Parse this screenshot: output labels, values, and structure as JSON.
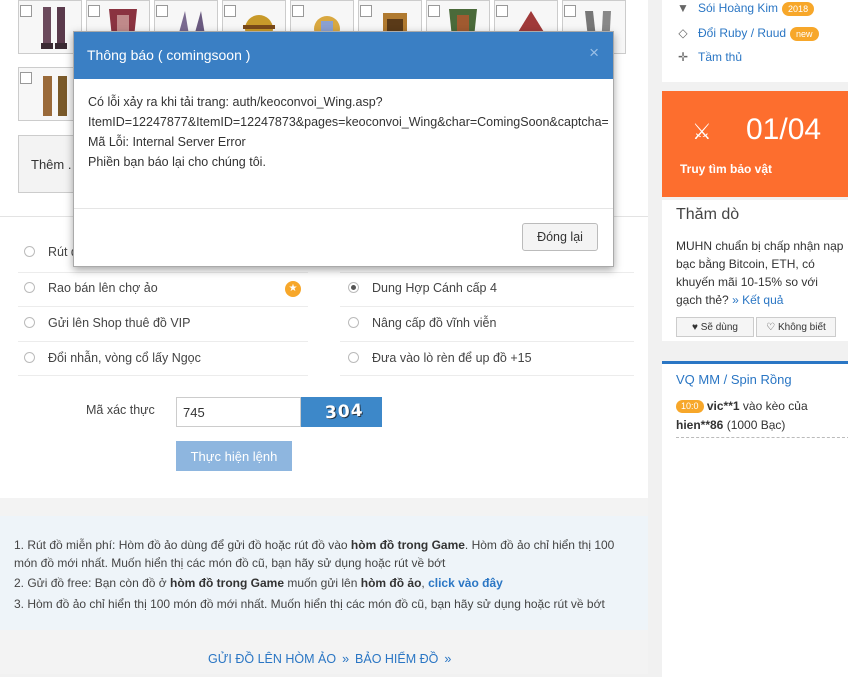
{
  "items": [
    {
      "name": "item-boots"
    },
    {
      "name": "item-armor"
    },
    {
      "name": "item-gloves"
    },
    {
      "name": "item-helmet-gold"
    },
    {
      "name": "item-helmet-blue"
    },
    {
      "name": "item-gauntlet"
    },
    {
      "name": "item-armor-green"
    },
    {
      "name": "item-helm-red"
    },
    {
      "name": "item-boots-grey"
    },
    {
      "name": "item-leg-armor"
    }
  ],
  "add_button": "Thêm .",
  "options": {
    "withdraw": "Rút đ",
    "sell_market": "Rao bán lên chợ ảo",
    "rent_vip": "Gửi lên Shop thuê đồ VIP",
    "swap_ring": "Đổi nhẫn, vòng cổ lấy Ngọc",
    "merge_wing": "Dung Hợp Cánh cấp 4",
    "upgrade_forever": "Nâng cấp đồ vĩnh viễn",
    "forge_15": "Đưa vào lò rèn để up đồ +15",
    "star_badge": "★"
  },
  "captcha": {
    "label": "Mã xác thực",
    "value": "745",
    "image_text": "304"
  },
  "execute_button": "Thực hiện lệnh",
  "notes": {
    "line1_a": "1. Rút đồ miễn phí: Hòm đồ ảo dùng để gửi đồ hoặc rút đồ vào ",
    "line1_b": "hòm đồ trong Game",
    "line1_c": ". Hòm đồ ảo chỉ hiển thị 100 món đồ mới nhất. Muốn hiển thị các món đồ cũ, bạn hãy sử dụng hoặc rút về bớt",
    "line2_a": "2. Gửi đồ free: Bạn còn đồ ở ",
    "line2_b": "hòm đồ trong Game",
    "line2_c": " muốn gửi lên ",
    "line2_d": "hòm đồ ảo",
    "line2_e": ", ",
    "line2_link": "click vào đây",
    "line3": "3. Hòm đồ ảo chỉ hiển thị 100 món đồ mới nhất. Muốn hiển thị các món đồ cũ, bạn hãy sử dụng hoặc rút về bớt"
  },
  "footer": {
    "link1": "GỬI ĐỒ LÊN HÒM ẢO",
    "chev": "»",
    "link2": "BẢO HIỂM ĐỒ"
  },
  "sidebar": {
    "row1": "Sói Hoàng Kim",
    "row1_badge": "2018",
    "row2": "Đổi Ruby / Ruud",
    "row2_badge": "new",
    "row3": "Tầm thủ",
    "treasure_count": "01/04",
    "treasure_label": "Truy tìm bảo vật",
    "poll_title": "Thăm dò",
    "poll_text": "MUHN chuẩn bị chấp nhận nạp bạc bằng Bitcoin, ETH, có khuyến mãi 10-15% so với gạch thẻ?",
    "poll_result": "» Kết quả",
    "poll_yes": "♥ Sẽ dùng",
    "poll_no": "♡ Không biết",
    "spin_title": "VQ MM / Spin Rồng",
    "spin_pill": "10:0",
    "spin_user1": "vic**1",
    "spin_mid": " vào kèo của ",
    "spin_user2": "hien**86",
    "spin_tail": " (1000 Bạc)"
  },
  "modal": {
    "title": "Thông báo ( comingsoon )",
    "close": "×",
    "line1": "Có lỗi xảy ra khi tải trang: auth/keoconvoi_Wing.asp?",
    "line2": "ItemID=12247877&ItemID=12247873&pages=keoconvoi_Wing&char=ComingSoon&captcha=745",
    "line3": "Mã Lỗi: Internal Server Error",
    "line4": "Phiền bạn báo lại cho chúng tôi.",
    "button": "Đóng lại"
  },
  "colors": {
    "accent": "#3a7fc4",
    "orange": "#fd6e2e",
    "badge": "#f7a72a"
  }
}
